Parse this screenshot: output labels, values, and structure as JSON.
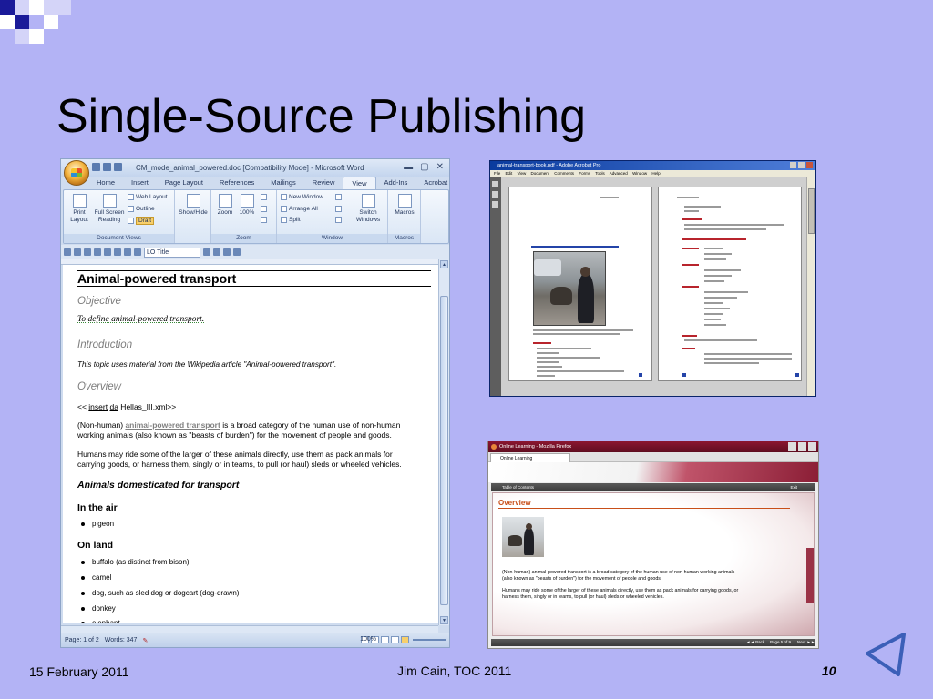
{
  "slide": {
    "title": "Single-Source Publishing",
    "date": "15 February 2011",
    "author": "Jim Cain, TOC 2011",
    "page_number": "10",
    "colors": {
      "background": "#b3b3f5",
      "accent_navy": "#1a1a99"
    }
  },
  "word": {
    "title": "CM_mode_animal_powered.doc [Compatibility Mode] - Microsoft Word",
    "tabs": [
      "Home",
      "Insert",
      "Page Layout",
      "References",
      "Mailings",
      "Review",
      "View",
      "Add-Ins",
      "Acrobat"
    ],
    "active_tab": "View",
    "ribbon": {
      "document_views": {
        "label": "Document Views",
        "print_layout": "Print Layout",
        "full_screen": "Full Screen Reading",
        "web_layout": "Web Layout",
        "outline": "Outline",
        "draft": "Draft"
      },
      "show_hide": "Show/Hide",
      "zoom": {
        "label": "Zoom",
        "zoom_btn": "Zoom",
        "percent_btn": "100%"
      },
      "window": {
        "label": "Window",
        "new_window": "New Window",
        "arrange_all": "Arrange All",
        "split": "Split",
        "switch_windows": "Switch Windows"
      },
      "macros": {
        "label": "Macros",
        "btn": "Macros"
      }
    },
    "style_box": "LO Title",
    "doc": {
      "heading": "Animal-powered transport",
      "objective_h": "Objective",
      "objective_text": "To define animal-powered transport.",
      "intro_h": "Introduction",
      "intro_text": "This topic uses material from the Wikipedia article \"Animal-powered transport\".",
      "overview_h": "Overview",
      "insert_prefix": "<< ",
      "insert_word": "insert",
      "insert_da": "da",
      "insert_suffix": " Hellas_III.xml>>",
      "para1_start": "(Non-human) ",
      "para1_link": "animal-powered transport",
      "para1_end": " is a broad category of the human use of non-human",
      "para1_line2": "working animals (also known as \"beasts of burden\") for the movement of people and goods.",
      "para2_line1": "Humans may ride some of the larger of these animals directly, use them as pack animals for",
      "para2_line2": "carrying goods, or harness them, singly or in teams, to pull (or haul) sleds or wheeled vehicles.",
      "section_h": "Animals domesticated for transport",
      "air_h": "In the air",
      "air_items": [
        "pigeon"
      ],
      "land_h": "On land",
      "land_items": [
        "buffalo (as distinct from bison)",
        "camel",
        "dog, such as sled dog or dogcart (dog-drawn)",
        "donkey",
        "elephant"
      ]
    },
    "status": {
      "page": "Page: 1 of 2",
      "words": "Words: 347",
      "zoom": "100%"
    }
  },
  "acrobat": {
    "title": "animal-transport-book.pdf - Adobe Acrobat Pro",
    "menu": [
      "File",
      "Edit",
      "View",
      "Document",
      "Comments",
      "Forms",
      "Tools",
      "Advanced",
      "Window",
      "Help"
    ]
  },
  "firefox": {
    "title": "Online Learning - Mozilla Firefox",
    "tab": "Online Learning",
    "nav_left": "Table of Contents",
    "nav_right": "Exit",
    "heading": "Overview",
    "p1_line1": "(Non-human) animal-powered transport is a broad category of the human use of non-human working animals",
    "p1_line2": "(also known as \"beasts of burden\") for the movement of people and goods.",
    "p2_line1": "Humans may ride some of the larger of these animals directly, use them as pack animals for carrying goods, or",
    "p2_line2": "harness them, singly or in teams, to pull (or haul) sleds or wheeled vehicles.",
    "footer_back": "◄◄ Back",
    "footer_page": "Page 5 of 9",
    "footer_next": "Next ►►"
  }
}
